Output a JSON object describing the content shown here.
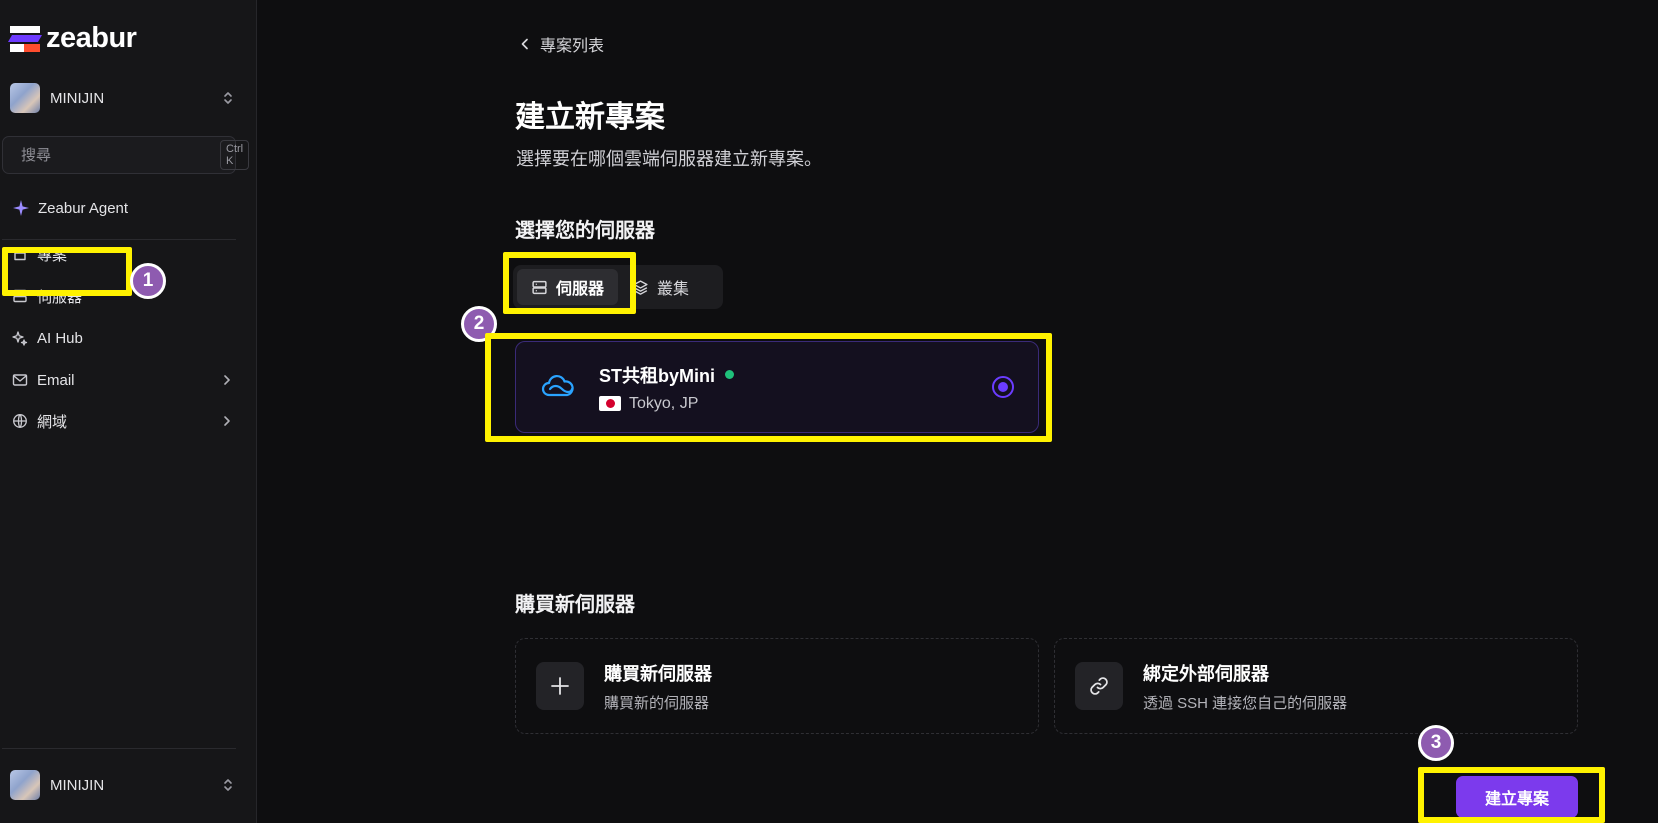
{
  "app": {
    "logo_text": "zeabur"
  },
  "sidebar": {
    "account_top": {
      "name": "MINIJIN"
    },
    "search": {
      "placeholder": "搜尋",
      "shortcut": "Ctrl K"
    },
    "agent": {
      "label": "Zeabur Agent"
    },
    "items": [
      {
        "label": "專案",
        "icon": "project-icon"
      },
      {
        "label": "伺服器",
        "icon": "server-icon"
      },
      {
        "label": "AI Hub",
        "icon": "sparkle-icon"
      },
      {
        "label": "Email",
        "icon": "mail-icon"
      },
      {
        "label": "網域",
        "icon": "globe-icon"
      }
    ],
    "account_bottom": {
      "name": "MINIJIN"
    }
  },
  "main": {
    "back_label": "專案列表",
    "title": "建立新專案",
    "subtitle": "選擇要在哪個雲端伺服器建立新專案。",
    "select_server_title": "選擇您的伺服器",
    "tabs": [
      {
        "label": "伺服器",
        "active": true
      },
      {
        "label": "叢集",
        "active": false
      }
    ],
    "server": {
      "name": "ST共租byMini",
      "location": "Tokyo, JP",
      "status_color": "#1fc07a",
      "selected": true
    },
    "buy_section_title": "購買新伺服器",
    "buy_cards": [
      {
        "title": "購買新伺服器",
        "description": "購買新的伺服器",
        "icon": "plus-icon"
      },
      {
        "title": "綁定外部伺服器",
        "description": "透過 SSH 連接您自己的伺服器",
        "icon": "link-icon"
      }
    ],
    "create_button": "建立專案"
  },
  "annotations": {
    "badges": [
      "1",
      "2",
      "3"
    ],
    "highlight_color": "#fff200"
  },
  "colors": {
    "accent": "#7c3aed",
    "background": "#0e0e10",
    "sidebar": "#161618"
  }
}
